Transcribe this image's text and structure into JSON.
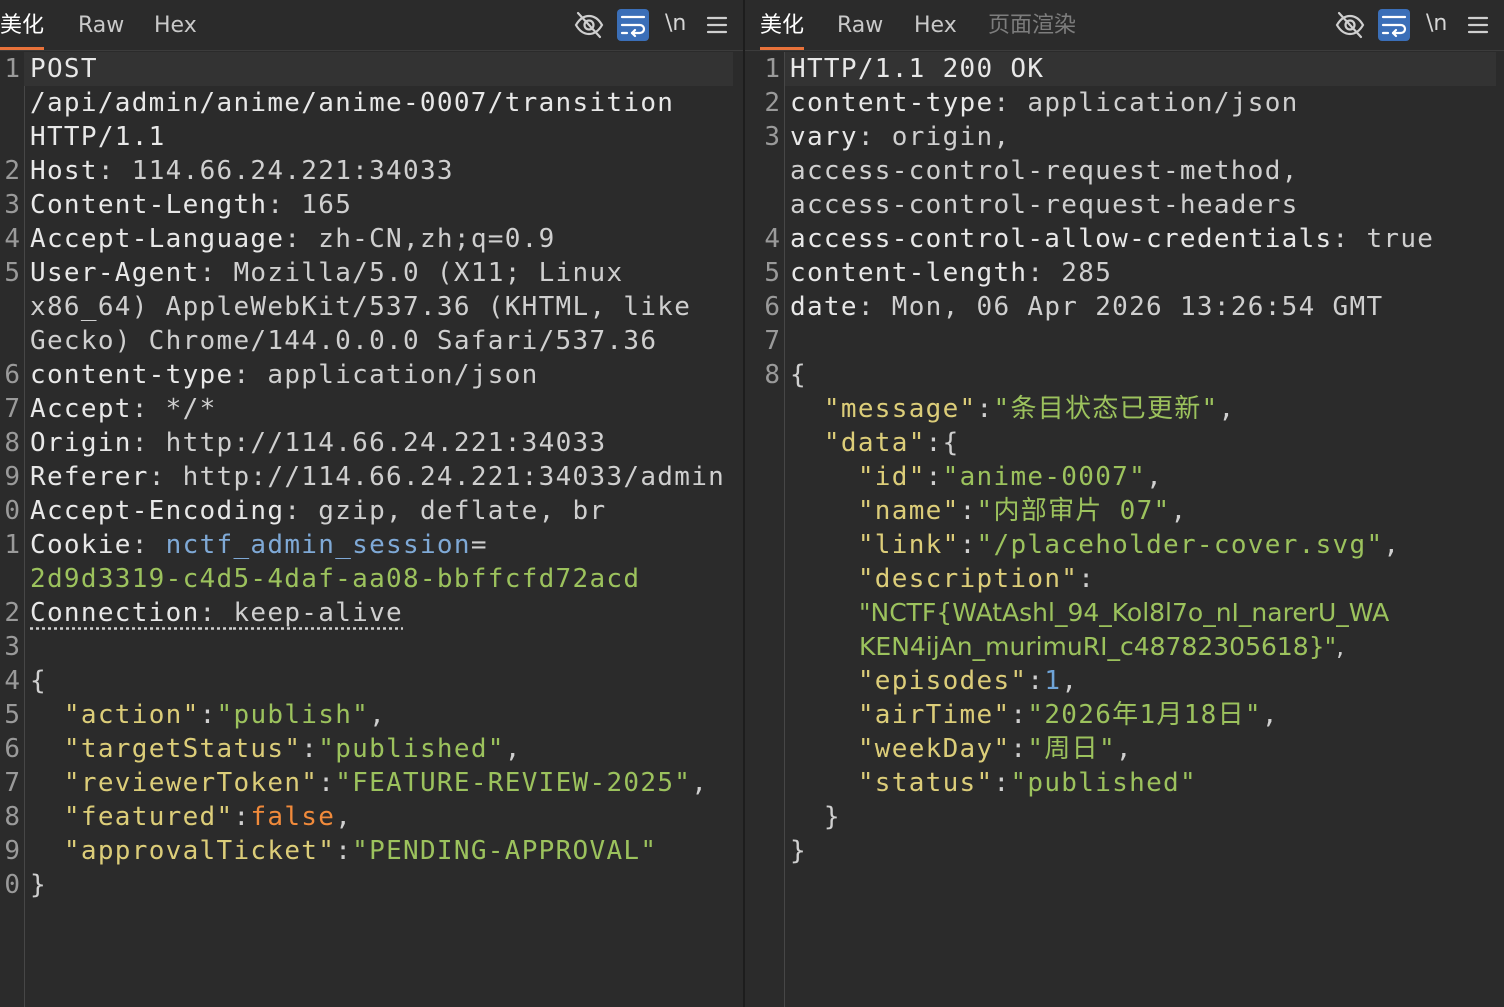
{
  "request": {
    "tabs": [
      "美化",
      "Raw",
      "Hex"
    ],
    "line_numbers": [
      "1",
      "2",
      "3",
      "4",
      "5",
      "6",
      "7",
      "8",
      "9",
      "0",
      "1",
      "2",
      "3",
      "4",
      "5",
      "6",
      "7",
      "8",
      "9",
      "0"
    ],
    "raw": {
      "l1a": "POST",
      "l1b": "/api/admin/anime/anime-0007/transition",
      "l1c": "HTTP/1.1",
      "host_k": "Host",
      "host_v": "114.66.24.221:34033",
      "cl_k": "Content-Length",
      "cl_v": "165",
      "al_k": "Accept-Language",
      "al_v": "zh-CN,zh;q=0.9",
      "ua_k": "User-Agent",
      "ua_v1": "Mozilla/5.0 (X11; Linux",
      "ua_v2": "x86_64) AppleWebKit/537.36 (KHTML, like",
      "ua_v3": "Gecko) Chrome/144.0.0.0 Safari/537.36",
      "ct_k": "content-type",
      "ct_v": "application/json",
      "ac_k": "Accept",
      "ac_v": "*/*",
      "or_k": "Origin",
      "or_v": "http://114.66.24.221:34033",
      "ref_k": "Referer",
      "ref_v": "http://114.66.24.221:34033/admin",
      "ae_k": "Accept-Encoding",
      "ae_v": "gzip, deflate, br",
      "ck_k": "Cookie",
      "ck_name": "nctf_admin_session",
      "ck_v": "2d9d3319-c4d5-4daf-aa08-bbffcfd72acd",
      "cn_k": "Connection",
      "cn_v": "keep-alive"
    },
    "body": {
      "action_k": "\"action\"",
      "action_v": "\"publish\"",
      "ts_k": "\"targetStatus\"",
      "ts_v": "\"published\"",
      "rt_k": "\"reviewerToken\"",
      "rt_v": "\"FEATURE-REVIEW-2025\"",
      "ft_k": "\"featured\"",
      "ft_v": "false",
      "at_k": "\"approvalTicket\"",
      "at_v": "\"PENDING-APPROVAL\""
    }
  },
  "response": {
    "tabs": [
      "美化",
      "Raw",
      "Hex",
      "页面渲染"
    ],
    "line_numbers": [
      "1",
      "2",
      "3",
      "4",
      "5",
      "6",
      "7",
      "8"
    ],
    "raw": {
      "status": "HTTP/1.1 200 OK",
      "ct_k": "content-type",
      "ct_v": "application/json",
      "vary_k": "vary",
      "vary_v1": "origin,",
      "vary_v2": "access-control-request-method,",
      "vary_v3": "access-control-request-headers",
      "acac_k": "access-control-allow-credentials",
      "acac_v": "true",
      "cl_k": "content-length",
      "cl_v": "285",
      "date_k": "date",
      "date_v": "Mon, 06 Apr 2026 13:26:54 GMT"
    },
    "body": {
      "msg_k": "\"message\"",
      "msg_v": "\"条目状态已更新\"",
      "data_k": "\"data\"",
      "id_k": "\"id\"",
      "id_v": "\"anime-0007\"",
      "name_k": "\"name\"",
      "name_v": "\"内部审片 07\"",
      "link_k": "\"link\"",
      "link_v": "\"/placeholder-cover.svg\"",
      "desc_k": "\"description\"",
      "desc_v1": "\"NCTF{WAtAshl_94_Kol8l7o_nI_narerU_WA",
      "desc_v2": "KEN4ijAn_murimuRI_c48782305618}\"",
      "ep_k": "\"episodes\"",
      "ep_v": "1",
      "air_k": "\"airTime\"",
      "air_v": "\"2026年1月18日\"",
      "wd_k": "\"weekDay\"",
      "wd_v": "\"周日\"",
      "st_k": "\"status\"",
      "st_v": "\"published\""
    }
  },
  "toolbar": {
    "newline_label": "\\n",
    "icons": [
      "eye-off-icon",
      "wrap-icon",
      "newline-icon",
      "menu-icon"
    ]
  },
  "colors": {
    "background": "#2b2b2b",
    "accent_tab": "#e8723a",
    "json_key": "#dccd79",
    "json_string": "#9cc25d",
    "json_number": "#6fa4d8",
    "json_bool": "#f08a3b",
    "active_tool": "#3b6fb8"
  }
}
